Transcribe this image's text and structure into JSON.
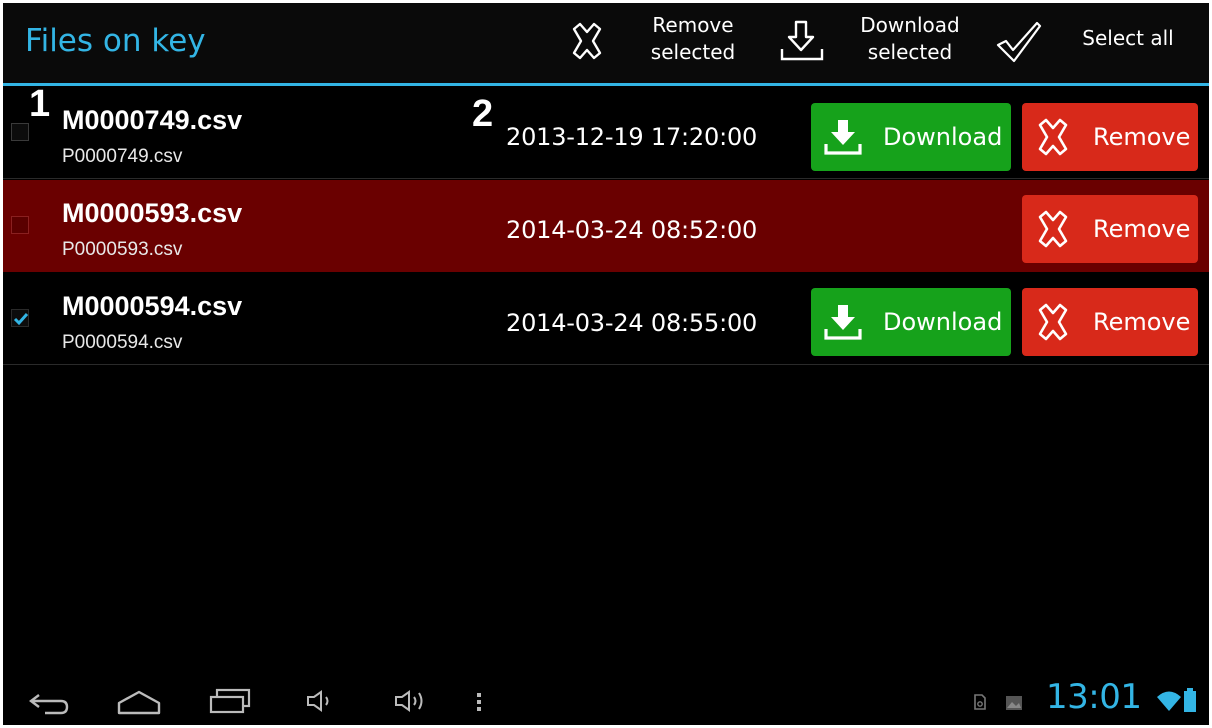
{
  "action_bar": {
    "title": "Files on key",
    "remove_selected": [
      "Remove",
      "selected"
    ],
    "download_selected": [
      "Download",
      "selected"
    ],
    "select_all": "Select all"
  },
  "annotations": [
    "1",
    "2"
  ],
  "files": [
    {
      "name": "M0000749.csv",
      "sub": "P0000749.csv",
      "date": "2013-12-19 17:20:00",
      "checked": false,
      "failed": false,
      "download": "Download",
      "remove": "Remove"
    },
    {
      "name": "M0000593.csv",
      "sub": "P0000593.csv",
      "date": "2014-03-24 08:52:00",
      "checked": false,
      "failed": true,
      "remove": "Remove"
    },
    {
      "name": "M0000594.csv",
      "sub": "P0000594.csv",
      "date": "2014-03-24 08:55:00",
      "checked": true,
      "failed": false,
      "download": "Download",
      "remove": "Remove"
    }
  ],
  "status_bar": {
    "time": "13:01",
    "icons": [
      "sd-card-icon",
      "image-icon",
      "wifi-icon",
      "battery-icon"
    ]
  },
  "nav_bar": {
    "icons": [
      "back-icon",
      "home-icon",
      "recent-apps-icon",
      "volume-down-icon",
      "volume-up-icon",
      "menu-icon"
    ]
  },
  "colors": {
    "accent": "#33b5e5",
    "download": "#16a21b",
    "remove": "#d8291a",
    "failed_row": "#6a0000"
  }
}
